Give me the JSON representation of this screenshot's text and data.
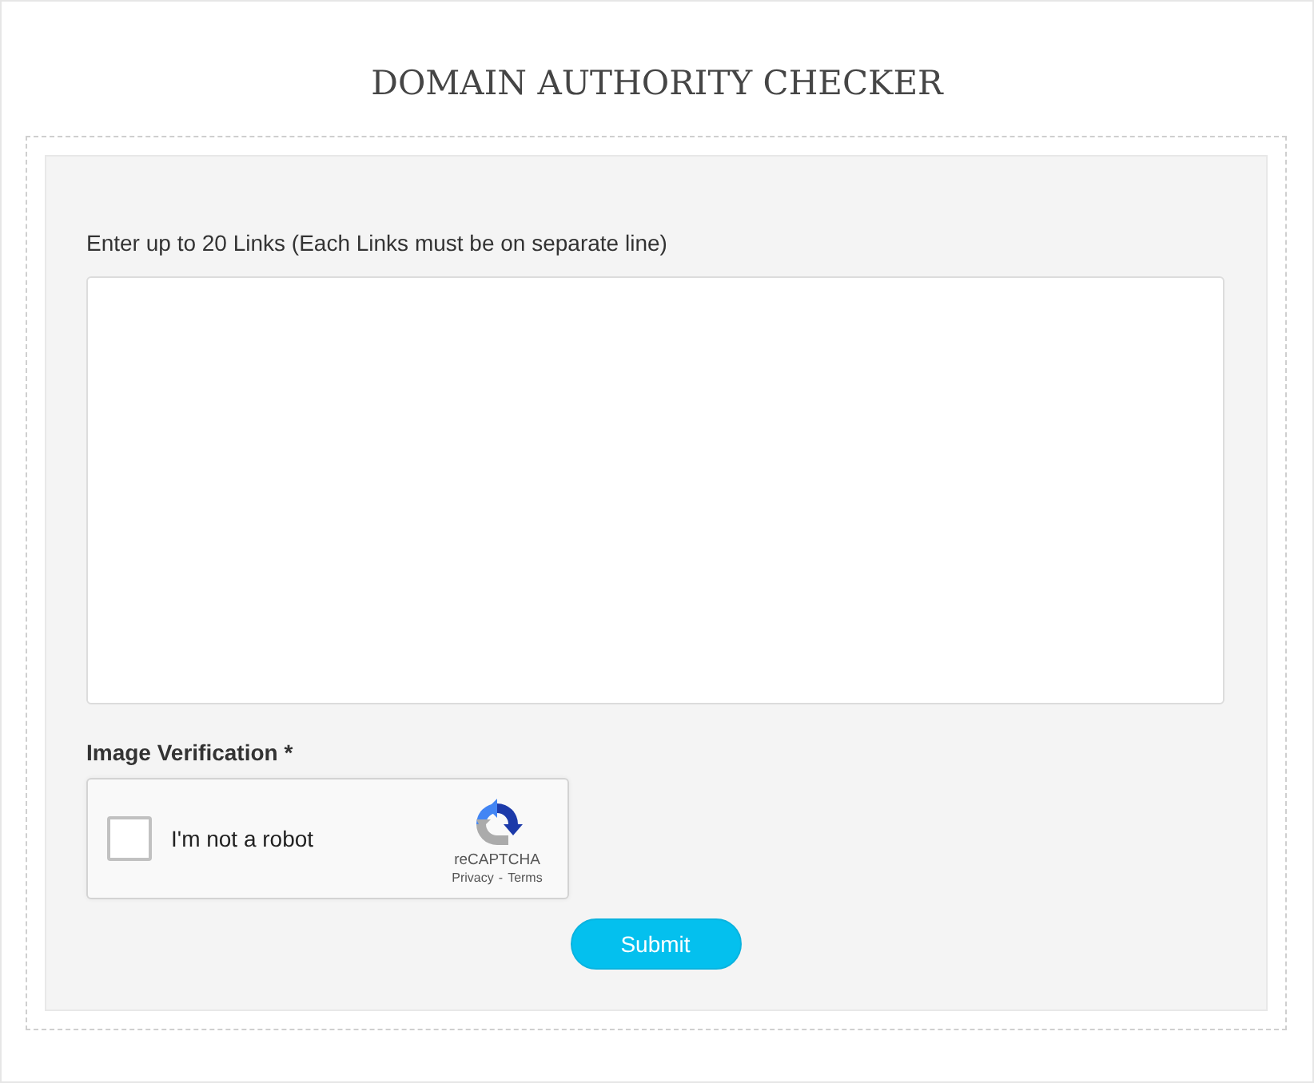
{
  "title": "DOMAIN AUTHORITY CHECKER",
  "links_field": {
    "label": "Enter up to 20 Links (Each Links must be on separate line)"
  },
  "verification": {
    "label": "Image Verification *",
    "captcha": {
      "checked": false,
      "text": "I'm not a robot",
      "brand": "reCAPTCHA",
      "links": [
        {
          "label": "Privacy"
        },
        {
          "label": "Terms"
        }
      ],
      "separator": "-"
    }
  },
  "buttons": [
    {
      "label": "Submit"
    }
  ]
}
